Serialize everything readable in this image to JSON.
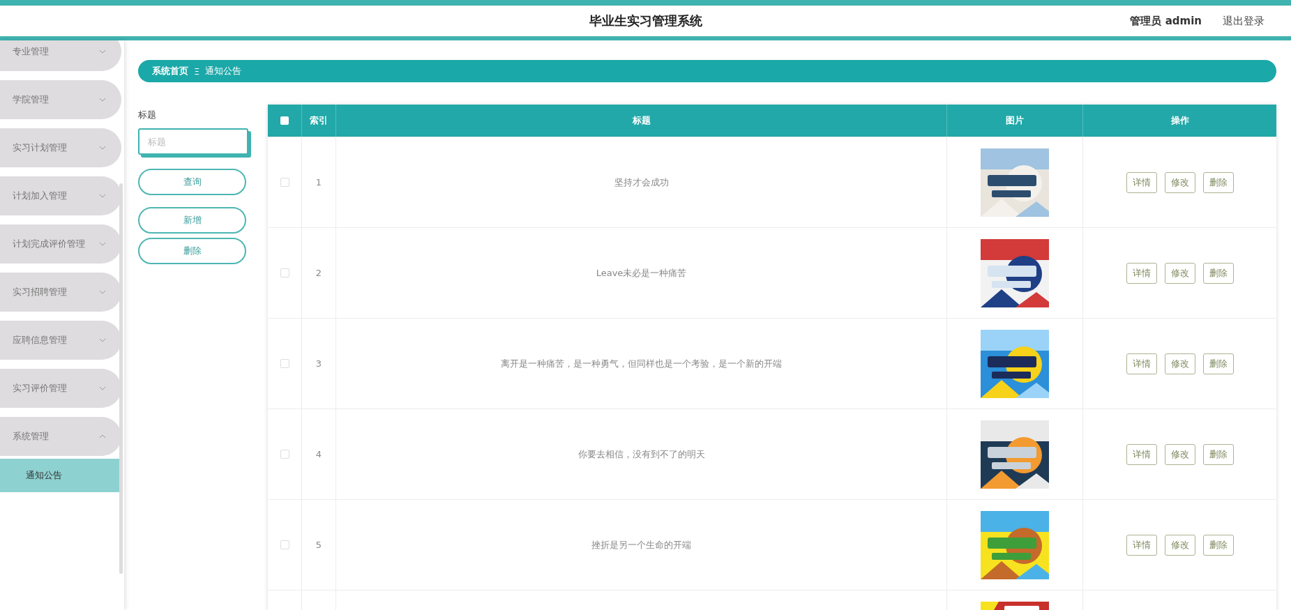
{
  "header": {
    "title": "毕业生实习管理系统",
    "user": "管理员 admin",
    "logout": "退出登录"
  },
  "sidebar": {
    "items": [
      {
        "label": "专业管理",
        "expanded": false
      },
      {
        "label": "学院管理",
        "expanded": false
      },
      {
        "label": "实习计划管理",
        "expanded": false
      },
      {
        "label": "计划加入管理",
        "expanded": false
      },
      {
        "label": "计划完成评价管理",
        "expanded": false
      },
      {
        "label": "实习招聘管理",
        "expanded": false
      },
      {
        "label": "应聘信息管理",
        "expanded": false
      },
      {
        "label": "实习评价管理",
        "expanded": false
      },
      {
        "label": "系统管理",
        "expanded": true,
        "children": [
          {
            "label": "通知公告",
            "selected": true
          }
        ]
      }
    ]
  },
  "breadcrumb": {
    "home": "系统首页",
    "separator": "Ξ",
    "current": "通知公告"
  },
  "search": {
    "label": "标题",
    "placeholder": "标题",
    "buttons": [
      "查询",
      "新增",
      "删除"
    ]
  },
  "table": {
    "header_checkbox": {
      "checked": false
    },
    "columns": [
      "索引",
      "标题",
      "图片",
      "操作"
    ],
    "rows": [
      {
        "checked": false,
        "index": "1",
        "title": "坚持才会成功",
        "picture": {
          "kind": "picture"
        },
        "actions": [
          "详情",
          "修改",
          "删除"
        ]
      },
      {
        "checked": false,
        "index": "2",
        "title": "Leave未必是一种痛苦",
        "picture": {
          "kind": "picture"
        },
        "actions": [
          "详情",
          "修改",
          "删除"
        ]
      },
      {
        "checked": false,
        "index": "3",
        "title": "离开是一种痛苦，是一种勇气，但同样也是一个考验，是一个新的开端",
        "picture": {
          "kind": "picture"
        },
        "actions": [
          "详情",
          "修改",
          "删除"
        ]
      },
      {
        "checked": false,
        "index": "4",
        "title": "你要去相信，没有到不了的明天",
        "picture": {
          "kind": "picture"
        },
        "actions": [
          "详情",
          "修改",
          "删除"
        ]
      },
      {
        "checked": false,
        "index": "5",
        "title": "挫折是另一个生命的开端",
        "picture": {
          "kind": "picture"
        },
        "actions": [
          "详情",
          "修改",
          "删除"
        ]
      }
    ],
    "partial_row": {
      "picture": {
        "kind": "picture"
      }
    }
  }
}
